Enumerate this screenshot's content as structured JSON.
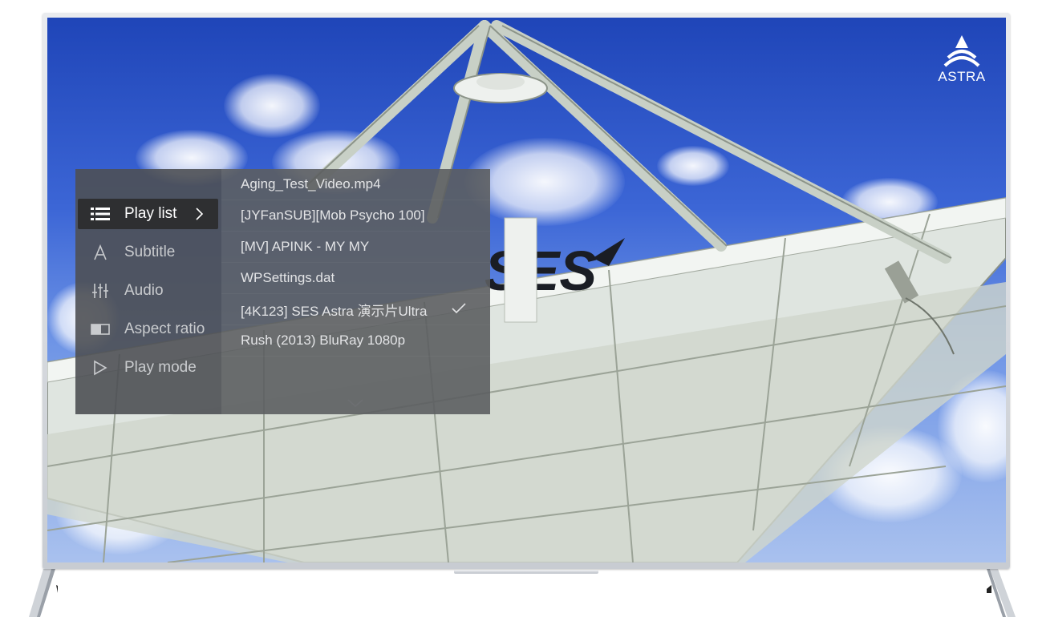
{
  "brand": {
    "name": "ASTRA"
  },
  "screen": {
    "dish_logo_text": "SES"
  },
  "menu": {
    "categories": [
      {
        "label": "Play list",
        "icon": "list-icon",
        "active": true,
        "has_submenu": true
      },
      {
        "label": "Subtitle",
        "icon": "subtitle-icon",
        "active": false
      },
      {
        "label": "Audio",
        "icon": "equalizer-icon",
        "active": false
      },
      {
        "label": "Aspect ratio",
        "icon": "aspect-ratio-icon",
        "active": false
      },
      {
        "label": "Play mode",
        "icon": "play-icon",
        "active": false
      }
    ],
    "playlist": [
      {
        "label": "Aging_Test_Video.mp4",
        "selected": false
      },
      {
        "label": "[JYFanSUB][Mob Psycho 100]",
        "selected": false
      },
      {
        "label": "[MV] APINK - MY MY",
        "selected": false
      },
      {
        "label": "WPSettings.dat",
        "selected": false
      },
      {
        "label": "[4K123] SES Astra 演示片Ultra",
        "selected": true
      },
      {
        "label": "Rush (2013) BluRay 1080p",
        "selected": false
      }
    ]
  },
  "colors": {
    "menu_left_bg": "#4e5054",
    "menu_right_bg": "#5c5e61",
    "active_item_bg": "#2e2f31",
    "sky": "#2f59cc"
  }
}
